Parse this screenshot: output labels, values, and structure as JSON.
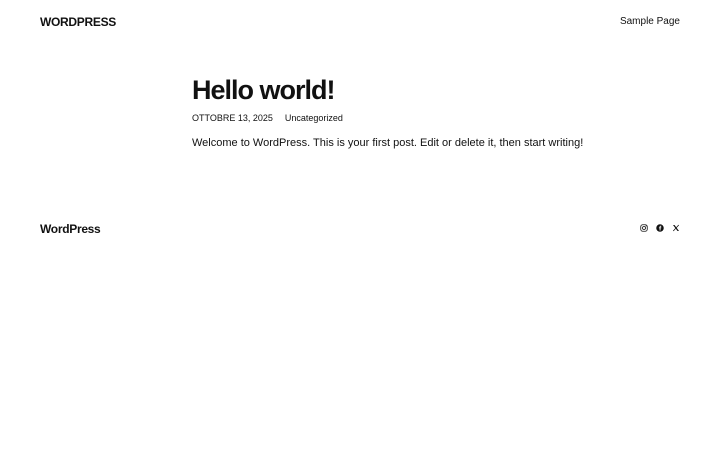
{
  "header": {
    "site_title": "WORDPRESS",
    "nav": [
      {
        "label": "Sample Page"
      }
    ]
  },
  "post": {
    "title": "Hello world!",
    "date": "OTTOBRE 13, 2025",
    "category": "Uncategorized",
    "content": "Welcome to WordPress. This is your first post. Edit or delete it, then start writing!"
  },
  "footer": {
    "site_title": "WordPress",
    "social": [
      "instagram-icon",
      "facebook-icon",
      "x-icon"
    ]
  },
  "colors": {
    "text": "#111111",
    "background": "#ffffff"
  }
}
